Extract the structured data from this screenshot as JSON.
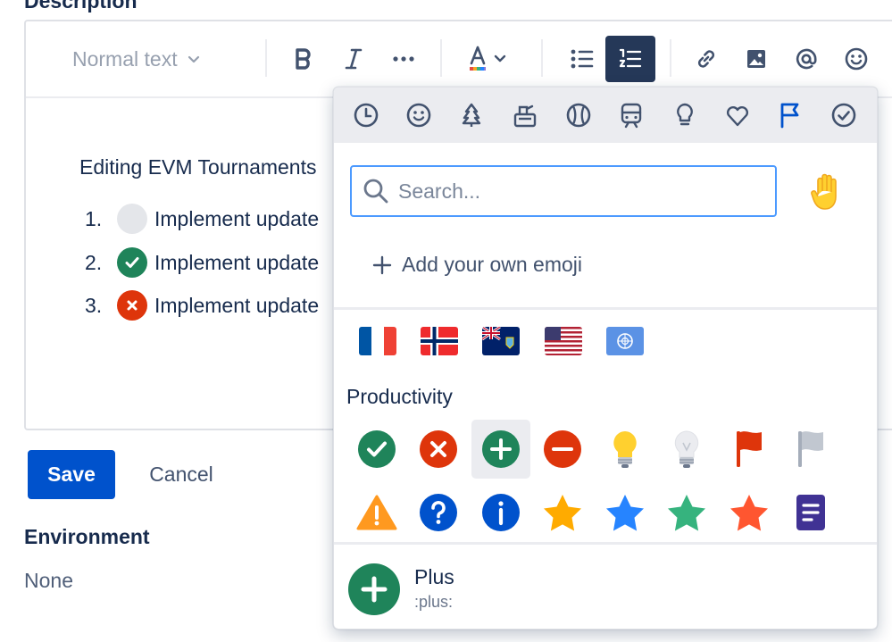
{
  "description": {
    "heading": "Description"
  },
  "toolbar": {
    "text_style": "Normal text",
    "buttons": [
      "bold",
      "italic",
      "more",
      "text-color",
      "bullet-list",
      "numbered-list",
      "link",
      "image",
      "mention",
      "emoji"
    ],
    "active": "numbered-list",
    "colors": {
      "active_bg": "#253858",
      "text_color_bar": [
        "#e44d42",
        "#f5a623",
        "#36b37e",
        "#2684ff",
        "#8777d9"
      ]
    }
  },
  "editor": {
    "paragraph": "Editing EVM Tournaments",
    "list": [
      {
        "number": "1.",
        "status": "empty",
        "text": "Implement update"
      },
      {
        "number": "2.",
        "status": "done",
        "text": "Implement update"
      },
      {
        "number": "3.",
        "status": "failed",
        "text": "Implement update"
      }
    ]
  },
  "actions": {
    "save_label": "Save",
    "cancel_label": "Cancel"
  },
  "environment": {
    "heading": "Environment",
    "value": "None"
  },
  "emoji_picker": {
    "categories": [
      "frequent",
      "people",
      "nature",
      "foods",
      "activity",
      "travel",
      "objects",
      "symbols",
      "flags",
      "productivity"
    ],
    "selected_category": "flags",
    "search": {
      "placeholder": "Search...",
      "value": ""
    },
    "add_own_label": "Add your own emoji",
    "flags": [
      "france",
      "norway",
      "tristan-da-cunha",
      "united-states",
      "united-nations"
    ],
    "productivity_label": "Productivity",
    "productivity": [
      [
        "check-mark",
        "cross-mark",
        "plus",
        "minus",
        "light-bulb-on",
        "light-bulb-off",
        "red-flag",
        "grey-flag"
      ],
      [
        "warning",
        "question",
        "info",
        "yellow-star",
        "blue-star",
        "green-star",
        "red-star",
        "editor-note"
      ]
    ],
    "hovered": "plus",
    "preview": {
      "name": "Plus",
      "shortcode": ":plus:"
    },
    "colors": {
      "accent": "#0052cc",
      "success": "#1f845a",
      "danger": "#de350b",
      "info": "#0052cc"
    }
  }
}
